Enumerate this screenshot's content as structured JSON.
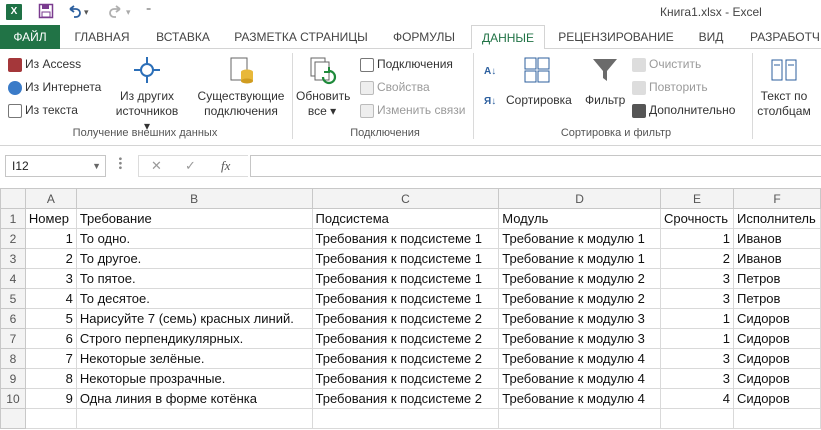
{
  "window": {
    "title": "Книга1.xlsx - Excel",
    "logo": "X"
  },
  "quick_access": {
    "icons": [
      "save-icon",
      "undo-icon",
      "redo-icon",
      "customize-icon"
    ]
  },
  "tabs": [
    {
      "label": "ФАЙЛ",
      "id": "file"
    },
    {
      "label": "ГЛАВНАЯ",
      "id": "home"
    },
    {
      "label": "ВСТАВКА",
      "id": "insert"
    },
    {
      "label": "РАЗМЕТКА СТРАНИЦЫ",
      "id": "layout"
    },
    {
      "label": "ФОРМУЛЫ",
      "id": "formulas"
    },
    {
      "label": "ДАННЫЕ",
      "id": "data"
    },
    {
      "label": "РЕЦЕНЗИРОВАНИЕ",
      "id": "review"
    },
    {
      "label": "ВИД",
      "id": "view"
    },
    {
      "label": "РАЗРАБОТЧ",
      "id": "developer"
    }
  ],
  "active_tab": "ДАННЫЕ",
  "ribbon": {
    "external": {
      "from_access": "Из Access",
      "from_web": "Из Интернета",
      "from_text": "Из текста",
      "from_other_1": "Из других",
      "from_other_2": "источников",
      "existing_1": "Существующие",
      "existing_2": "подключения",
      "group_label": "Получение внешних данных"
    },
    "connections": {
      "refresh_1": "Обновить",
      "refresh_2": "все",
      "connections": "Подключения",
      "properties": "Свойства",
      "edit_links": "Изменить связи",
      "group_label": "Подключения"
    },
    "sort_filter": {
      "sort": "Сортировка",
      "filter": "Фильтр",
      "clear": "Очистить",
      "reapply": "Повторить",
      "advanced": "Дополнительно",
      "group_label": "Сортировка и фильтр"
    },
    "tools": {
      "text_to_cols_1": "Текст по",
      "text_to_cols_2": "столбцам"
    }
  },
  "formula_bar": {
    "name_box": "I12",
    "formula": "",
    "cancel_glyph": "✕",
    "enter_glyph": "✓",
    "fx_glyph": "fx"
  },
  "sheet": {
    "columns": [
      "A",
      "B",
      "C",
      "D",
      "E",
      "F"
    ],
    "rows": [
      {
        "n": "1",
        "cells": [
          "Номер",
          "Требование",
          "Подсистема",
          "Модуль",
          "Срочность",
          "Исполнитель"
        ]
      },
      {
        "n": "2",
        "cells": [
          "1",
          "То одно.",
          "Требования к подсистеме 1",
          "Требование к модулю 1",
          "1",
          "Иванов"
        ]
      },
      {
        "n": "3",
        "cells": [
          "2",
          "То другое.",
          "Требования к подсистеме 1",
          "Требование к модулю 1",
          "2",
          "Иванов"
        ]
      },
      {
        "n": "4",
        "cells": [
          "3",
          "То пятое.",
          "Требования к подсистеме 1",
          "Требование к модулю 2",
          "3",
          "Петров"
        ]
      },
      {
        "n": "5",
        "cells": [
          "4",
          "То десятое.",
          "Требования к подсистеме 1",
          "Требование к модулю 2",
          "3",
          "Петров"
        ]
      },
      {
        "n": "6",
        "cells": [
          "5",
          "Нарисуйте 7 (семь) красных линий.",
          "Требования к подсистеме 2",
          "Требование к модулю 3",
          "1",
          "Сидоров"
        ]
      },
      {
        "n": "7",
        "cells": [
          "6",
          "Строго перпендикулярных.",
          "Требования к подсистеме 2",
          "Требование к модулю 3",
          "1",
          "Сидоров"
        ]
      },
      {
        "n": "8",
        "cells": [
          "7",
          "Некоторые зелёные.",
          "Требования к подсистеме 2",
          "Требование к модулю 4",
          "3",
          "Сидоров"
        ]
      },
      {
        "n": "9",
        "cells": [
          "8",
          "Некоторые прозрачные.",
          "Требования к подсистеме 2",
          "Требование к модулю 4",
          "3",
          "Сидоров"
        ]
      },
      {
        "n": "10",
        "cells": [
          "9",
          "Одна линия в форме котёнка",
          "Требования к подсистеме 2",
          "Требование к модулю 4",
          "4",
          "Сидоров"
        ]
      }
    ]
  },
  "colors": {
    "excel_green": "#217346",
    "header_bg": "#f3f3f3",
    "gridline": "#d9d9d9"
  }
}
